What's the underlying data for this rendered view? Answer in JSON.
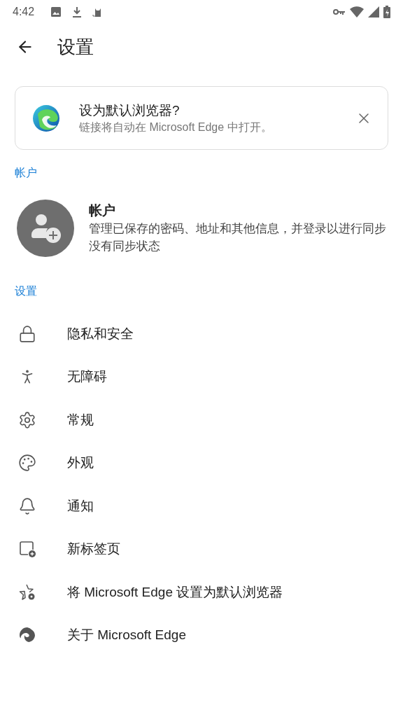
{
  "status_bar": {
    "time": "4:42"
  },
  "toolbar": {
    "title": "设置"
  },
  "banner": {
    "title": "设为默认浏览器?",
    "subtitle": "链接将自动在 Microsoft Edge 中打开。"
  },
  "account_section": {
    "header": "帐户",
    "title": "帐户",
    "description": "管理已保存的密码、地址和其他信息，并登录以进行同步",
    "status": "没有同步状态"
  },
  "settings_section": {
    "header": "设置",
    "items": [
      {
        "kind": "privacy",
        "label": "隐私和安全"
      },
      {
        "kind": "accessibility",
        "label": "无障碍"
      },
      {
        "kind": "general",
        "label": "常规"
      },
      {
        "kind": "appearance",
        "label": "外观"
      },
      {
        "kind": "notifications",
        "label": "通知"
      },
      {
        "kind": "new-tab",
        "label": "新标签页"
      },
      {
        "kind": "default-browser",
        "label": "将 Microsoft Edge 设置为默认浏览器"
      },
      {
        "kind": "about",
        "label": "关于 Microsoft Edge"
      }
    ]
  }
}
